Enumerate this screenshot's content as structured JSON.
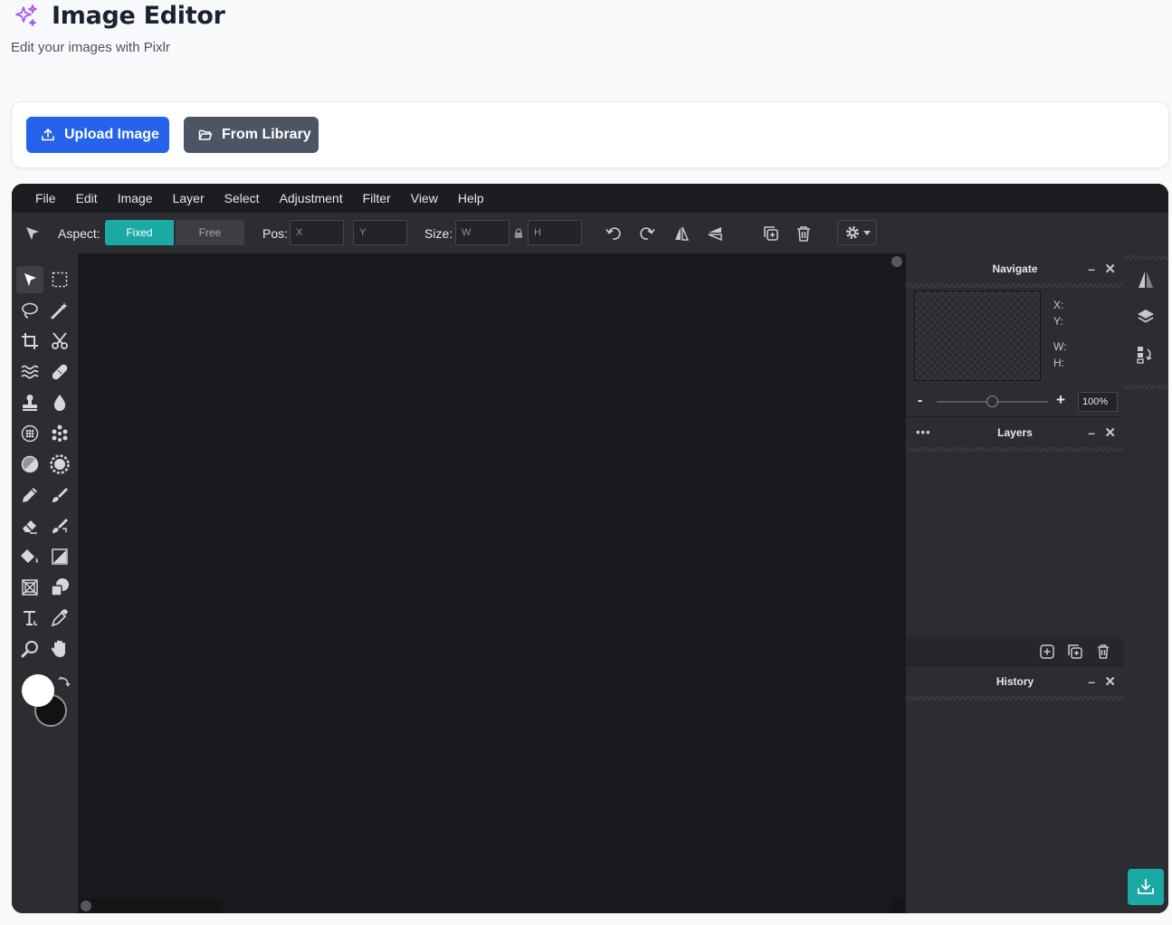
{
  "header": {
    "title": "Image Editor",
    "subtitle": "Edit your images with Pixlr",
    "icon": "sparkles-icon",
    "accent_color": "#a855f7"
  },
  "actions": {
    "upload_label": "Upload Image",
    "library_label": "From Library",
    "upload_color": "#2563eb",
    "library_color": "#4b5563"
  },
  "editor": {
    "menu": [
      "File",
      "Edit",
      "Image",
      "Layer",
      "Select",
      "Adjustment",
      "Filter",
      "View",
      "Help"
    ],
    "toolbar": {
      "aspect_label": "Aspect:",
      "aspect_fixed": "Fixed",
      "aspect_free": "Free",
      "pos_label": "Pos:",
      "pos_x_placeholder": "X",
      "pos_y_placeholder": "Y",
      "size_label": "Size:",
      "size_w_placeholder": "W",
      "size_h_placeholder": "H",
      "accent": "#1ba9a6"
    },
    "tools": [
      "arrange-tool-icon",
      "marquee-select-icon",
      "lasso-icon",
      "magic-wand-icon",
      "crop-icon",
      "cutout-scissors-icon",
      "liquify-icon",
      "heal-bandage-icon",
      "clone-stamp-icon",
      "blur-drop-icon",
      "sponge-icon",
      "dots-pattern-icon",
      "dodge-burn-icon",
      "color-replace-icon",
      "pencil-icon",
      "brush-icon",
      "eraser-icon",
      "replace-brush-icon",
      "fill-bucket-icon",
      "gradient-icon",
      "frame-icon",
      "shape-icon",
      "text-icon",
      "eyedropper-icon",
      "zoom-icon",
      "hand-icon"
    ],
    "panels": {
      "navigate": {
        "title": "Navigate",
        "x_label": "X:",
        "y_label": "Y:",
        "w_label": "W:",
        "h_label": "H:",
        "zoom_minus": "-",
        "zoom_plus": "+",
        "zoom_value": "100%",
        "zoom_level": 0.5
      },
      "layers": {
        "title": "Layers",
        "menu": "•••"
      },
      "history": {
        "title": "History"
      },
      "minimize": "–",
      "close": "✕"
    }
  }
}
